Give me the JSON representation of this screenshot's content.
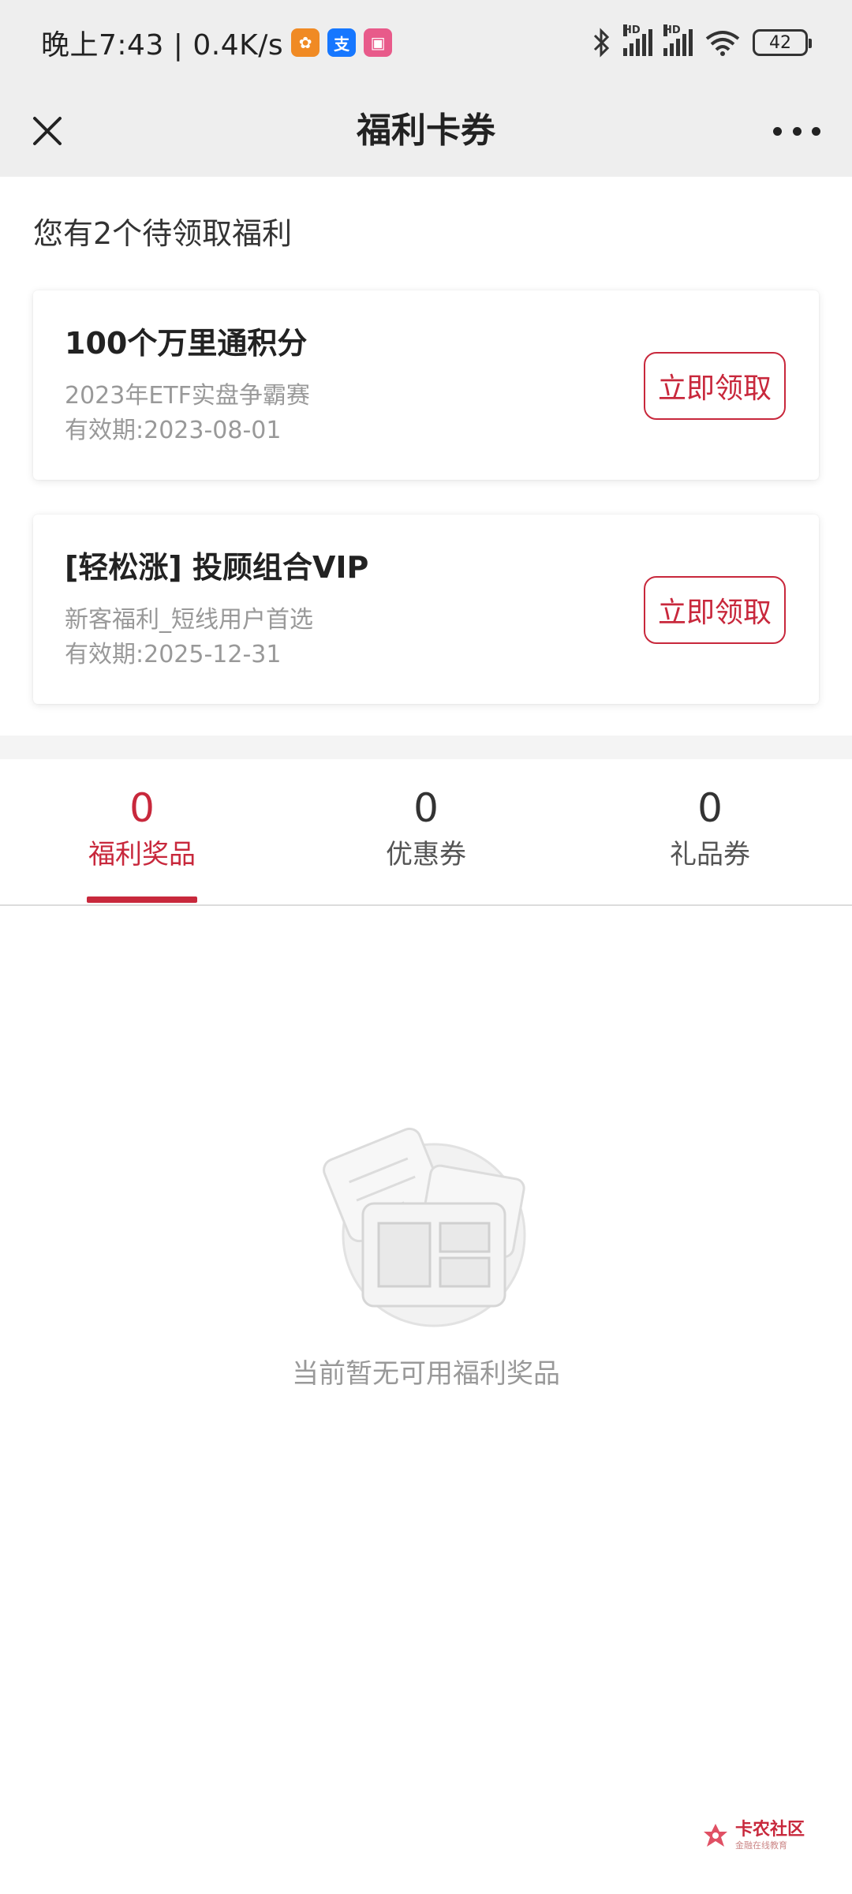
{
  "status_bar": {
    "time": "晚上7:43 | 0.4K/s",
    "battery": "42",
    "signal_label": "HD"
  },
  "nav": {
    "title": "福利卡券"
  },
  "pending": {
    "header": "您有2个待领取福利",
    "cards": [
      {
        "title": "100个万里通积分",
        "subtitle": "2023年ETF实盘争霸赛",
        "expiry": "有效期:2023-08-01",
        "button": "立即领取"
      },
      {
        "title": "[轻松涨] 投顾组合VIP",
        "subtitle": "新客福利_短线用户首选",
        "expiry": "有效期:2025-12-31",
        "button": "立即领取"
      }
    ]
  },
  "tabs": [
    {
      "count": "0",
      "label": "福利奖品",
      "active": true
    },
    {
      "count": "0",
      "label": "优惠券",
      "active": false
    },
    {
      "count": "0",
      "label": "礼品券",
      "active": false
    }
  ],
  "empty_state": {
    "text": "当前暂无可用福利奖品"
  },
  "watermark": {
    "main": "卡农社区",
    "sub": "金融在线教育"
  },
  "colors": {
    "accent": "#c8283c",
    "nav_background": "#eeeeee"
  }
}
